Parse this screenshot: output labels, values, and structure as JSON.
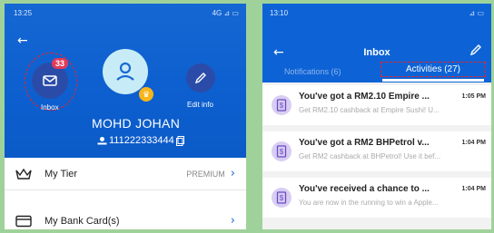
{
  "left": {
    "status": {
      "time": "13:25",
      "right": "4G ⊿ ▭"
    },
    "inbox": {
      "label": "Inbox",
      "badge": "33"
    },
    "edit": {
      "label": "Edit info"
    },
    "profile": {
      "name": "MOHD JOHAN",
      "phone": "111222333444"
    },
    "rows": [
      {
        "label": "My Tier",
        "value": "PREMIUM"
      },
      {
        "label": "My Bank Card(s)",
        "value": ""
      }
    ]
  },
  "right": {
    "status": {
      "time": "13:10",
      "right": "⊿ ▭"
    },
    "title": "Inbox",
    "tabs": {
      "notifications": "Notifications (6)",
      "activities": "Activities (27)"
    },
    "messages": [
      {
        "title": "You've got a RM2.10 Empire ...",
        "time": "1:05 PM",
        "body": "Get RM2.10 cashback at Empire Sushi! U..."
      },
      {
        "title": "You've got a RM2 BHPetrol v...",
        "time": "1:04 PM",
        "body": "Get RM2 cashback at BHPetrol! Use it bef..."
      },
      {
        "title": "You've received a chance to ...",
        "time": "1:04 PM",
        "body": "You are now in the running to win a Apple..."
      }
    ]
  }
}
